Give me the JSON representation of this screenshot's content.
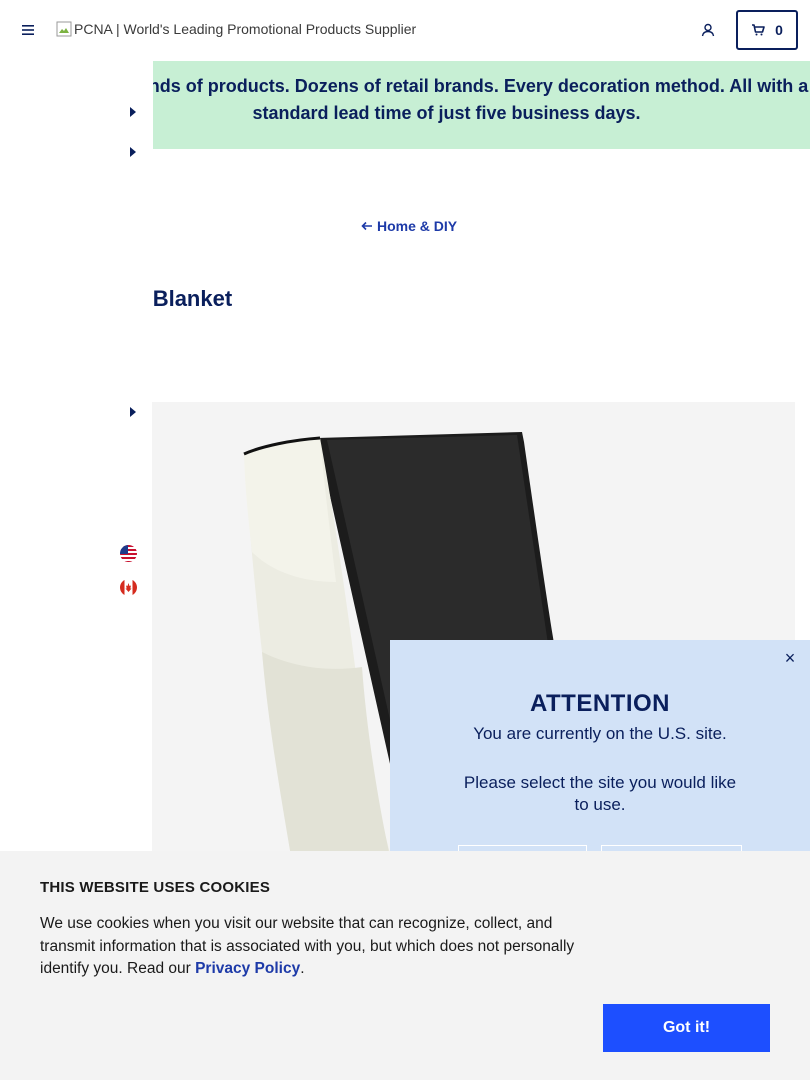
{
  "header": {
    "logo_alt": "PCNA | World's Leading Promotional Products Supplier",
    "cart_count": "0"
  },
  "banner": {
    "text": "Thousands of products. Dozens of retail brands. Every decoration method. All with a standard lead time of just five business days."
  },
  "breadcrumb": {
    "label": "Home & DIY"
  },
  "product": {
    "title": "Sherpa Blanket"
  },
  "attention": {
    "title": "ATTENTION",
    "line1": "You are currently on the U.S. site.",
    "line2": "Please select the site you would like to use.",
    "close_symbol": "×"
  },
  "cookie": {
    "title": "THIS WEBSITE USES COOKIES",
    "body": "We use cookies when you visit our website that can recognize, collect, and transmit information that is associated with you, but which does not personally identify you. Read our ",
    "link": "Privacy Policy",
    "end": ".",
    "button": "Got it!"
  },
  "colors": {
    "navy": "#0a1f5c",
    "banner_green": "#c7efd4",
    "modal_blue": "#d2e2f7",
    "button_blue": "#1d4fff"
  },
  "icons": [
    "menu-icon",
    "user-icon",
    "cart-icon",
    "arrow-left-icon",
    "caret-right-icon",
    "us-flag-icon",
    "canada-flag-icon",
    "close-icon"
  ]
}
